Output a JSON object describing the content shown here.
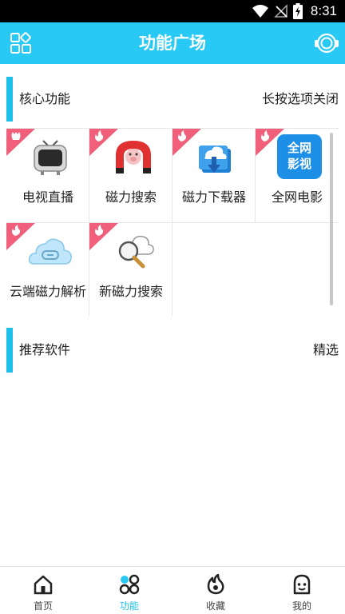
{
  "status_bar": {
    "time": "8:31"
  },
  "header": {
    "title": "功能广场",
    "left_icon": "apps-grid-icon",
    "right_icon": "customer-service-headset-icon"
  },
  "core_section": {
    "title": "核心功能",
    "action": "长按选项关闭"
  },
  "features": [
    {
      "label": "电视直播",
      "icon": "tv-icon",
      "badge": "tulip-ribbon"
    },
    {
      "label": "磁力搜索",
      "icon": "magnet-pig-icon",
      "badge": "flame-ribbon"
    },
    {
      "label": "磁力下载器",
      "icon": "cloud-download-icon",
      "badge": "flame-ribbon"
    },
    {
      "label": "全网电影",
      "icon": "all-net-video-icon",
      "icon_text": [
        "全网",
        "影视"
      ],
      "badge": "flame-ribbon"
    },
    {
      "label": "云端磁力解析",
      "icon": "cloud-magnet-icon",
      "badge": "flame-ribbon"
    },
    {
      "label": "新磁力搜索",
      "icon": "cloud-search-icon",
      "badge": "flame-ribbon"
    }
  ],
  "recommend_section": {
    "title": "推荐软件",
    "action": "精选"
  },
  "bottom_nav": [
    {
      "label": "首页",
      "icon": "home-icon",
      "active": false
    },
    {
      "label": "功能",
      "icon": "feature-grid-icon",
      "active": true
    },
    {
      "label": "收藏",
      "icon": "flame-icon",
      "active": false
    },
    {
      "label": "我的",
      "icon": "profile-icon",
      "active": false
    }
  ],
  "colors": {
    "accent": "#29c9f5",
    "section_accent": "#1ec0ea",
    "ribbon": "#f0607a",
    "text": "#222222"
  }
}
